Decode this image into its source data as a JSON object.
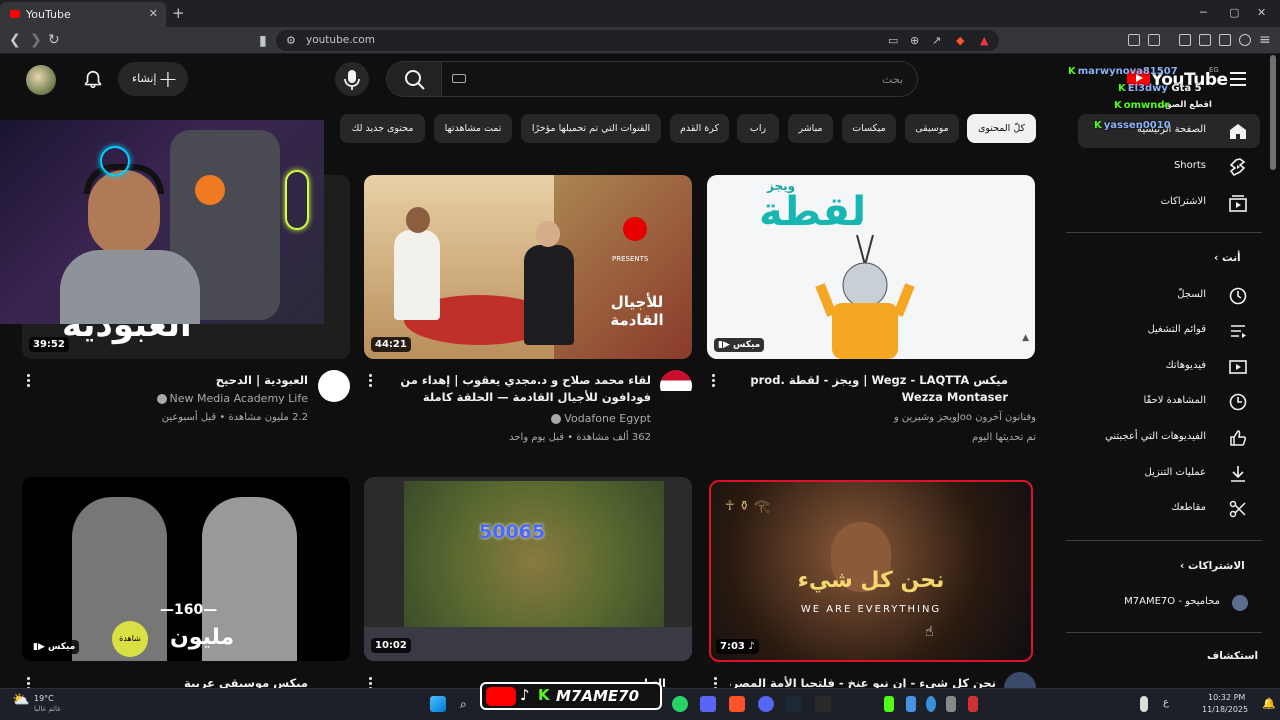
{
  "browser": {
    "tab_title": "YouTube",
    "tab_close": "✕",
    "new_tab": "+",
    "url": "youtube.com",
    "window_controls": [
      "─",
      "▢",
      "✕"
    ]
  },
  "header": {
    "create_label": "إنشاء",
    "search_placeholder": "بحث",
    "logo_text": "YouTube",
    "country_code": "EG"
  },
  "chat_overlay": [
    {
      "user": "marwynova81507",
      "msg": ""
    },
    {
      "user": "El3dwy",
      "msg": "Gta 5"
    },
    {
      "user": "",
      "msg": "اقطع الصوت"
    },
    {
      "user": "omwndr",
      "msg": ""
    },
    {
      "user": "",
      "msg": "الصفحة الرئيسية"
    },
    {
      "user": "yassen0010",
      "msg": ""
    }
  ],
  "chips": [
    "كلّ المحتوى",
    "موسيقى",
    "ميكسات",
    "مباشر",
    "راب",
    "كرة القدم",
    "القنوات التي تم تحميلها مؤخرًا",
    "تمت مشاهدتها",
    "محتوى جديد لك"
  ],
  "sidebar": {
    "main": [
      {
        "label": "الصفحة الرئيسية",
        "icon": "home-icon"
      },
      {
        "label": "Shorts",
        "icon": "shorts-icon"
      },
      {
        "label": "الاشتراكات",
        "icon": "subscriptions-icon"
      }
    ],
    "you_header": "أنت",
    "you": [
      {
        "label": "السجلّ",
        "icon": "history-icon"
      },
      {
        "label": "قوائم التشغيل",
        "icon": "playlists-icon"
      },
      {
        "label": "فيديوهاتك",
        "icon": "your-videos-icon"
      },
      {
        "label": "المشاهدة لاحقًا",
        "icon": "watch-later-icon"
      },
      {
        "label": "الفيديوهات التي أعجبتني",
        "icon": "liked-icon"
      },
      {
        "label": "عمليات التنزيل",
        "icon": "downloads-icon"
      },
      {
        "label": "مقاطعك",
        "icon": "clips-icon"
      }
    ],
    "subs_header": "الاشتراكات",
    "subs": [
      {
        "label": "M7AME7O - محاميحو"
      }
    ],
    "explore_header": "استكشاف"
  },
  "videos": [
    {
      "title": "ميكس Wegz - LAQTTA | ويجز - لقطة prod. Wezza Montaser",
      "channel": "ويجز وشيرين وJoo وفنانون آخرون",
      "meta": "تم تحديثها اليوم",
      "badge": "ميكس"
    },
    {
      "title": "لقاء محمد صلاح و د.مجدي يعقوب | إهداء من فودافون للأجيال القادمة — الحلقة كاملة",
      "channel": "Vodafone Egypt",
      "meta": "362 ألف مشاهدة • قبل يوم واحد",
      "duration": "44:21",
      "thumb_text": "للأجيال القادمة",
      "thumb_presents": "PRESENTS"
    },
    {
      "title": "العبودية | الدحيح",
      "channel": "New Media Academy Life",
      "meta": "2.2 مليون مشاهدة • قبل أسبوعين",
      "duration": "39:52"
    },
    {
      "title": "نحن كل شيء - إن نيو عنخ - فلتحيا الأمة المصرية | Tut",
      "duration": "7:03",
      "thumb_ar": "نحن كل شيء",
      "thumb_en": "WE ARE EVERYTHING"
    },
    {
      "title": "التيليس...",
      "duration": "10:02",
      "thumb_num": "50065"
    },
    {
      "title": "ميكس موسيقى عربية",
      "badge": "ميكس",
      "thumb_num": "—160—",
      "thumb_word": "مليون",
      "thumb_sticker": "شاهدة"
    }
  ],
  "thumb_logo_text": "ويجز",
  "thumb_laqta": "لقطة",
  "streamer_overlay": "M7AME70",
  "taskbar": {
    "weather_temp": "19°C",
    "weather_desc": "غائم غالبا",
    "time": "10:32 PM",
    "date": "11/18/2025",
    "lang": "ع"
  },
  "colors": {
    "bg": "#0f0f0f",
    "chip_bg": "#272727",
    "accent_red": "#ff0000",
    "kick_green": "#53fc18"
  }
}
